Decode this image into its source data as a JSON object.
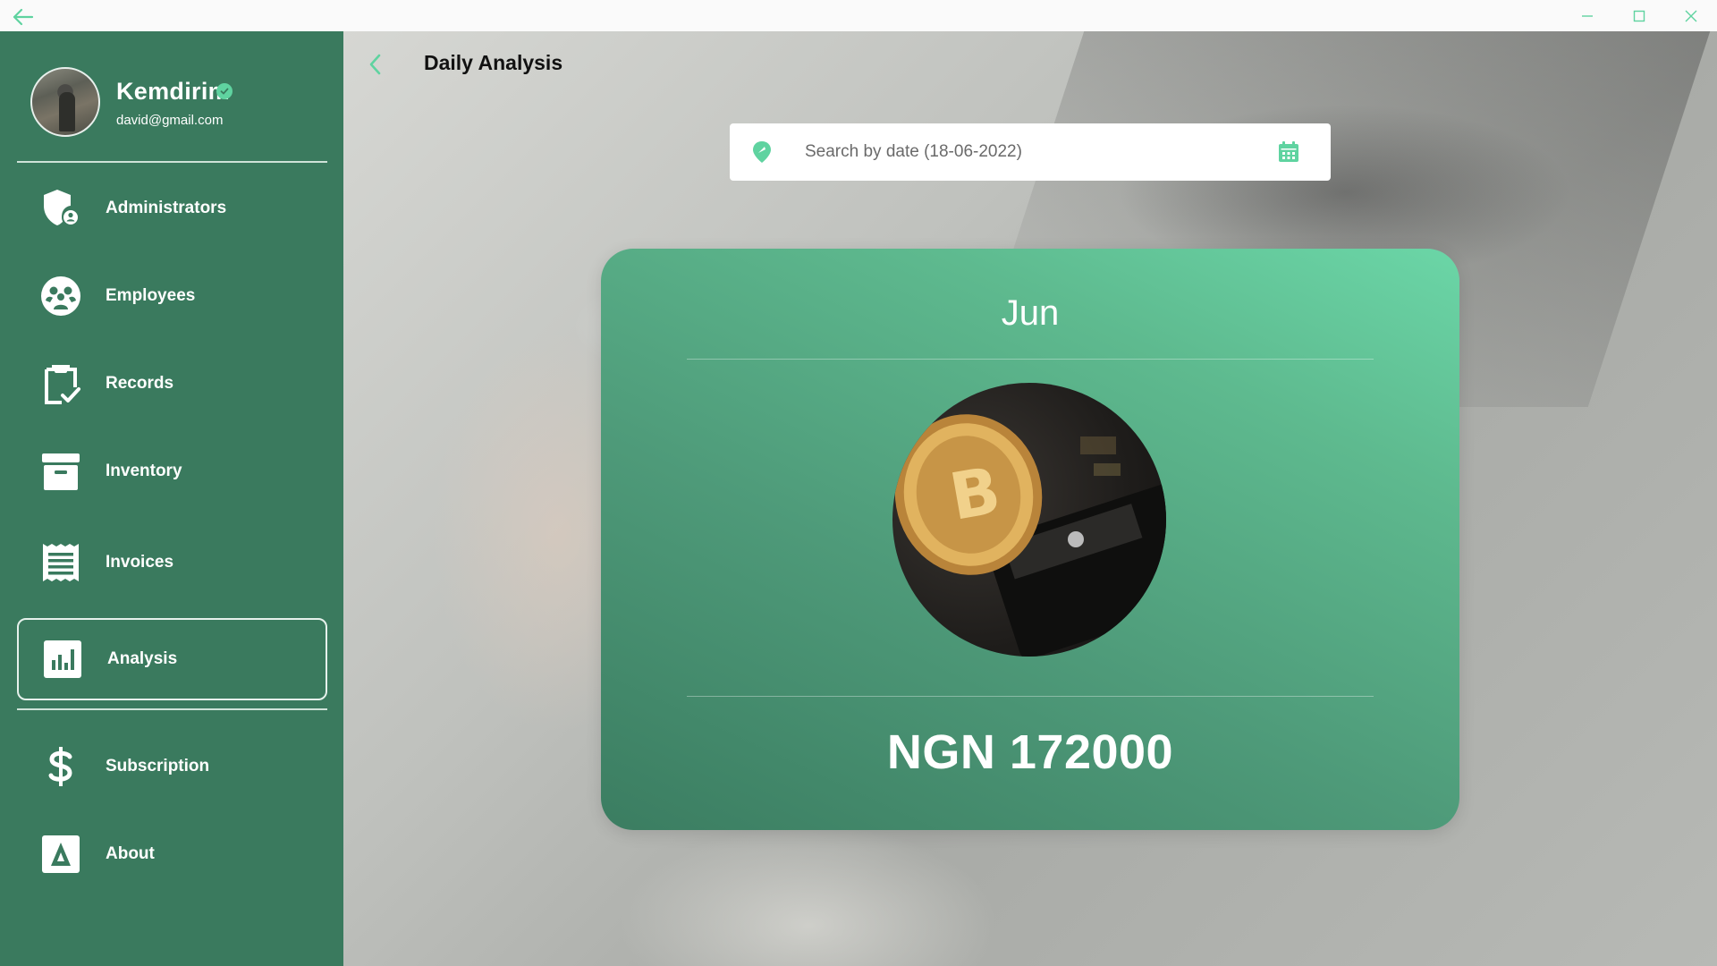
{
  "window": {
    "back_icon": "arrow-left-icon",
    "controls": [
      "minimize-icon",
      "maximize-icon",
      "close-icon"
    ]
  },
  "colors": {
    "sidebar": "#3a7a5e",
    "accent": "#5fd3a0",
    "card_start": "#3b7d61",
    "card_end": "#6bd6a7"
  },
  "profile": {
    "name": "Kemdirim",
    "email": "david@gmail.com",
    "verified_icon": "verified-check-icon"
  },
  "nav": {
    "items": [
      {
        "label": "Administrators",
        "icon": "shield-user-icon"
      },
      {
        "label": "Employees",
        "icon": "people-circle-icon"
      },
      {
        "label": "Records",
        "icon": "clipboard-check-icon"
      },
      {
        "label": "Inventory",
        "icon": "archive-box-icon"
      },
      {
        "label": "Invoices",
        "icon": "receipt-icon"
      },
      {
        "label": "Analysis",
        "icon": "bar-chart-icon",
        "active": true
      },
      {
        "label": "Subscription",
        "icon": "dollar-icon"
      },
      {
        "label": "About",
        "icon": "app-logo-icon"
      }
    ]
  },
  "header": {
    "back_icon": "chevron-left-icon",
    "title": "Daily Analysis"
  },
  "search": {
    "placeholder": "Search by date (18-06-2022)",
    "value": "",
    "pin_icon": "location-pin-icon",
    "calendar_icon": "calendar-icon"
  },
  "card": {
    "month": "Jun",
    "image": "bitcoin-coin-on-wallet",
    "amount": "NGN 172000"
  }
}
